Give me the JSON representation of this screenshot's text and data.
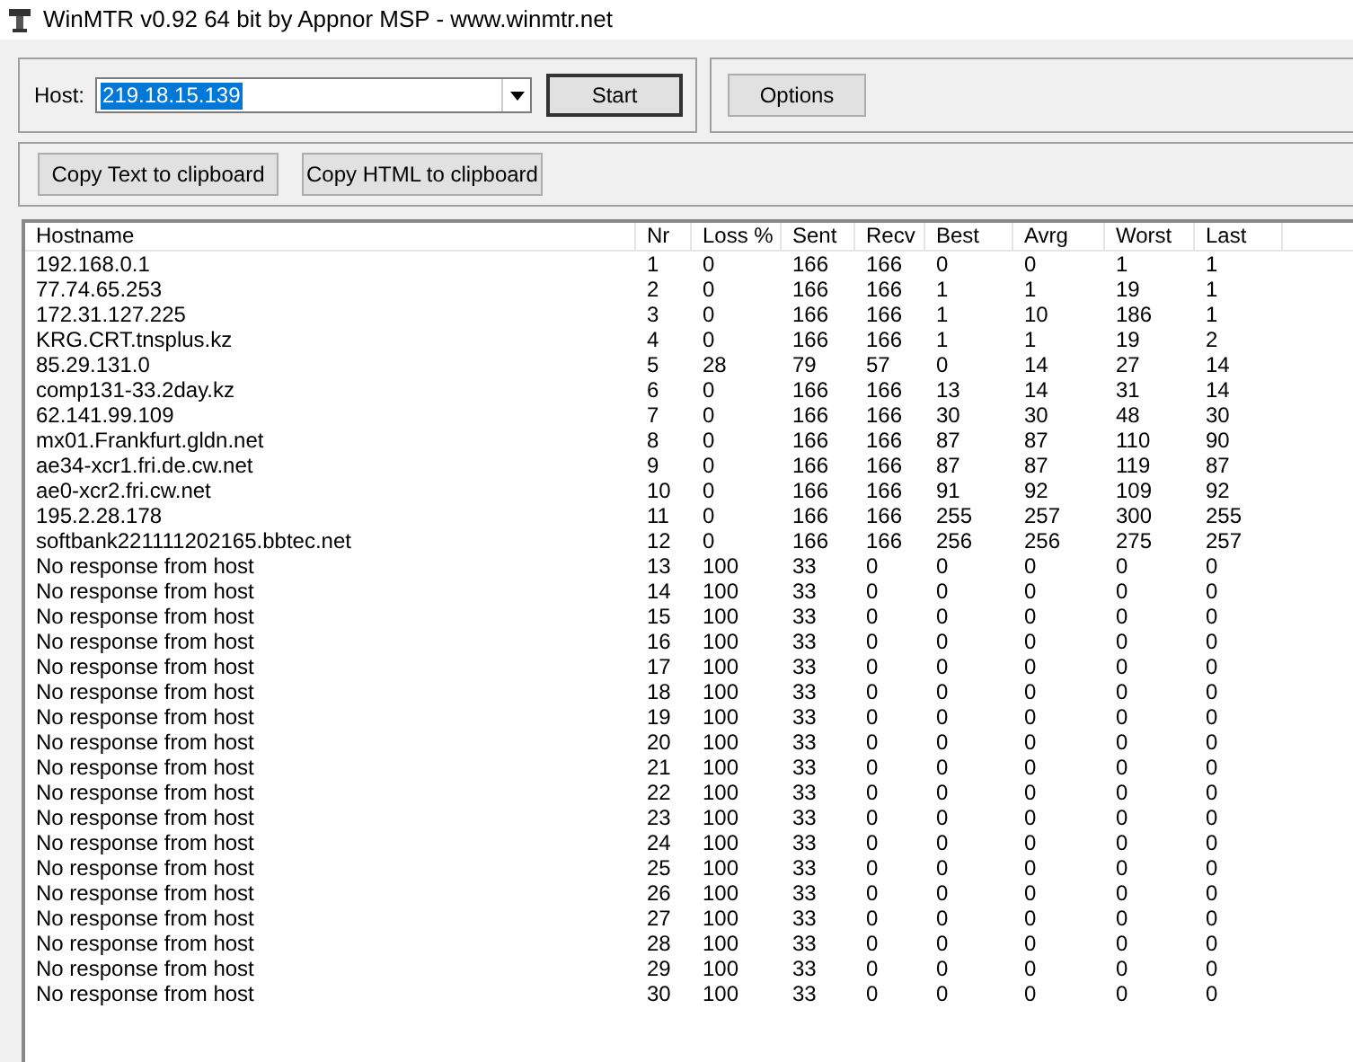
{
  "window": {
    "title": "WinMTR v0.92 64 bit by Appnor MSP - www.winmtr.net"
  },
  "host": {
    "label": "Host:",
    "value": "219.18.15.139",
    "text_selected": true
  },
  "buttons": {
    "start": "Start",
    "options": "Options",
    "copy_text": "Copy Text to clipboard",
    "copy_html": "Copy HTML to clipboard"
  },
  "table": {
    "columns": [
      "Hostname",
      "Nr",
      "Loss %",
      "Sent",
      "Recv",
      "Best",
      "Avrg",
      "Worst",
      "Last"
    ],
    "rows": [
      [
        "192.168.0.1",
        "1",
        "0",
        "166",
        "166",
        "0",
        "0",
        "1",
        "1"
      ],
      [
        "77.74.65.253",
        "2",
        "0",
        "166",
        "166",
        "1",
        "1",
        "19",
        "1"
      ],
      [
        "172.31.127.225",
        "3",
        "0",
        "166",
        "166",
        "1",
        "10",
        "186",
        "1"
      ],
      [
        "KRG.CRT.tnsplus.kz",
        "4",
        "0",
        "166",
        "166",
        "1",
        "1",
        "19",
        "2"
      ],
      [
        "85.29.131.0",
        "5",
        "28",
        "79",
        "57",
        "0",
        "14",
        "27",
        "14"
      ],
      [
        "comp131-33.2day.kz",
        "6",
        "0",
        "166",
        "166",
        "13",
        "14",
        "31",
        "14"
      ],
      [
        "62.141.99.109",
        "7",
        "0",
        "166",
        "166",
        "30",
        "30",
        "48",
        "30"
      ],
      [
        "mx01.Frankfurt.gldn.net",
        "8",
        "0",
        "166",
        "166",
        "87",
        "87",
        "110",
        "90"
      ],
      [
        "ae34-xcr1.fri.de.cw.net",
        "9",
        "0",
        "166",
        "166",
        "87",
        "87",
        "119",
        "87"
      ],
      [
        "ae0-xcr2.fri.cw.net",
        "10",
        "0",
        "166",
        "166",
        "91",
        "92",
        "109",
        "92"
      ],
      [
        "195.2.28.178",
        "11",
        "0",
        "166",
        "166",
        "255",
        "257",
        "300",
        "255"
      ],
      [
        "softbank221111202165.bbtec.net",
        "12",
        "0",
        "166",
        "166",
        "256",
        "256",
        "275",
        "257"
      ],
      [
        "No response from host",
        "13",
        "100",
        "33",
        "0",
        "0",
        "0",
        "0",
        "0"
      ],
      [
        "No response from host",
        "14",
        "100",
        "33",
        "0",
        "0",
        "0",
        "0",
        "0"
      ],
      [
        "No response from host",
        "15",
        "100",
        "33",
        "0",
        "0",
        "0",
        "0",
        "0"
      ],
      [
        "No response from host",
        "16",
        "100",
        "33",
        "0",
        "0",
        "0",
        "0",
        "0"
      ],
      [
        "No response from host",
        "17",
        "100",
        "33",
        "0",
        "0",
        "0",
        "0",
        "0"
      ],
      [
        "No response from host",
        "18",
        "100",
        "33",
        "0",
        "0",
        "0",
        "0",
        "0"
      ],
      [
        "No response from host",
        "19",
        "100",
        "33",
        "0",
        "0",
        "0",
        "0",
        "0"
      ],
      [
        "No response from host",
        "20",
        "100",
        "33",
        "0",
        "0",
        "0",
        "0",
        "0"
      ],
      [
        "No response from host",
        "21",
        "100",
        "33",
        "0",
        "0",
        "0",
        "0",
        "0"
      ],
      [
        "No response from host",
        "22",
        "100",
        "33",
        "0",
        "0",
        "0",
        "0",
        "0"
      ],
      [
        "No response from host",
        "23",
        "100",
        "33",
        "0",
        "0",
        "0",
        "0",
        "0"
      ],
      [
        "No response from host",
        "24",
        "100",
        "33",
        "0",
        "0",
        "0",
        "0",
        "0"
      ],
      [
        "No response from host",
        "25",
        "100",
        "33",
        "0",
        "0",
        "0",
        "0",
        "0"
      ],
      [
        "No response from host",
        "26",
        "100",
        "33",
        "0",
        "0",
        "0",
        "0",
        "0"
      ],
      [
        "No response from host",
        "27",
        "100",
        "33",
        "0",
        "0",
        "0",
        "0",
        "0"
      ],
      [
        "No response from host",
        "28",
        "100",
        "33",
        "0",
        "0",
        "0",
        "0",
        "0"
      ],
      [
        "No response from host",
        "29",
        "100",
        "33",
        "0",
        "0",
        "0",
        "0",
        "0"
      ],
      [
        "No response from host",
        "30",
        "100",
        "33",
        "0",
        "0",
        "0",
        "0",
        "0"
      ]
    ]
  }
}
